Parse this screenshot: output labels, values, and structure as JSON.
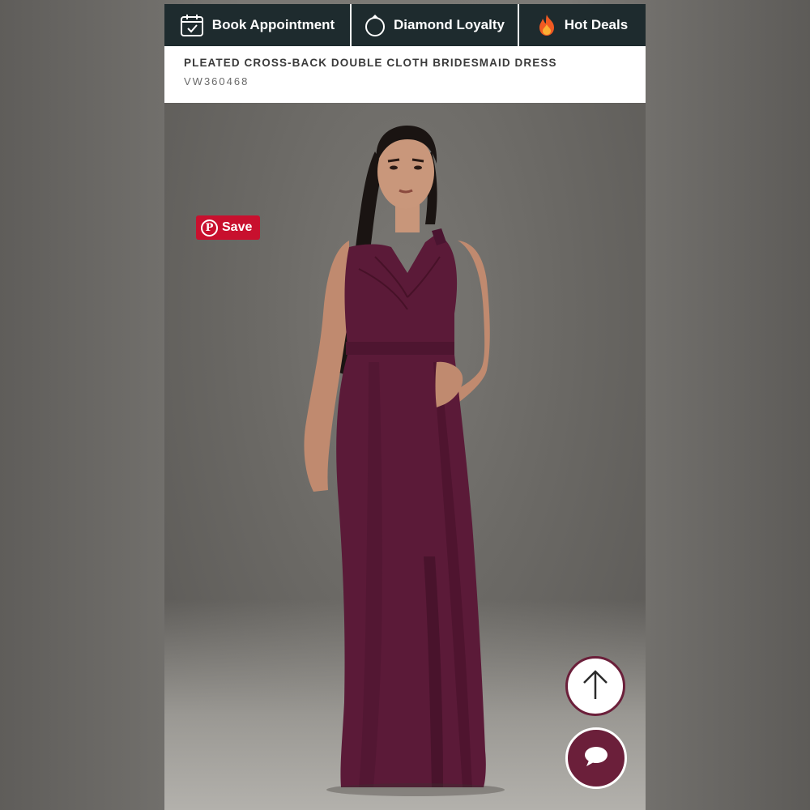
{
  "promo_bar": {
    "book_label": "Book Appointment",
    "book_icon": "calendar-check-icon",
    "loyalty_label": "Diamond Loyalty",
    "loyalty_icon": "ring-icon",
    "deals_label": "Hot Deals",
    "deals_icon": "fire-icon"
  },
  "product": {
    "title": "PLEATED CROSS-BACK DOUBLE CLOTH BRIDESMAID DRESS",
    "sku": "VW360468"
  },
  "pinterest": {
    "save_label": "Save",
    "icon": "pinterest-icon",
    "color": "#c8102e"
  },
  "fabs": {
    "scroll_top_icon": "arrow-up-icon",
    "chat_icon": "chat-bubble-icon",
    "accent_color": "#6b1f3a"
  },
  "colors": {
    "promo_bar": "#1e2b2e",
    "dress": "#5b1a38"
  }
}
